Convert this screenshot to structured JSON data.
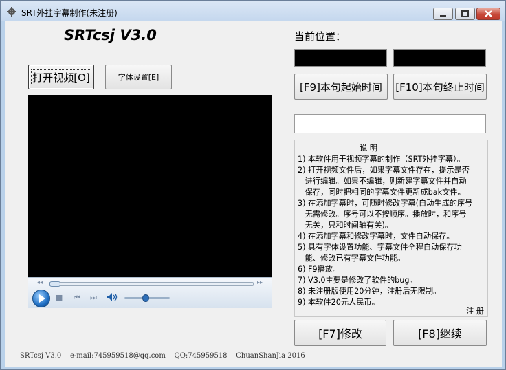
{
  "window": {
    "title": "SRT外挂字幕制作(未注册)"
  },
  "app": {
    "heading": "SRTcsj V3.0"
  },
  "buttons": {
    "open_video": "打开视频[O]",
    "font_settings": "字体设置[E]",
    "start_time": "[F9]本句起始时间",
    "end_time": "[F10]本句终止时间",
    "modify": "[F7]修改",
    "continue": "[F8]继续"
  },
  "position": {
    "label": "当前位置："
  },
  "subtitle_input": {
    "value": ""
  },
  "player": {
    "icons": [
      "play-icon",
      "stop-icon",
      "previous-icon",
      "next-icon",
      "volume-icon"
    ],
    "volume_level": 0.45,
    "seek_position": 0
  },
  "description": {
    "title": "说 明",
    "lines": [
      "1) 本软件用于视频字幕的制作（SRT外挂字幕）。",
      "2) 打开视频文件后，如果字幕文件存在，提示是否",
      "   进行编辑。如果不编辑，则新建字幕文件并自动",
      "   保存，同时把相同的字幕文件更新成bak文件。",
      "3) 在添加字幕时，可随时修改字幕(自动生成的序号",
      "   无需修改。序号可以不按顺序。播放时，和序号",
      "   无关，只和时间轴有关)。",
      "4) 在添加字幕和修改字幕时，文件自动保存。",
      "5) 具有字体设置功能、字幕文件全程自动保存功",
      "   能、修改已有字幕文件功能。",
      "6) F9播放。",
      "7) V3.0主要是修改了软件的bug。",
      "8) 未注册版使用20分钟，注册后无限制。",
      "9) 本软件20元人民币。"
    ],
    "register": "注 册"
  },
  "footer": {
    "text": "SRTcsj V3.0    e-mail:745959518@qq.com    QQ:745959518    ChuanShanJia 2016"
  },
  "colors": {
    "video_bg": "#000000",
    "chrome_frame": "#b9d1ea",
    "client_bg": "#f0f0f0",
    "close_button": "#c7493a"
  }
}
